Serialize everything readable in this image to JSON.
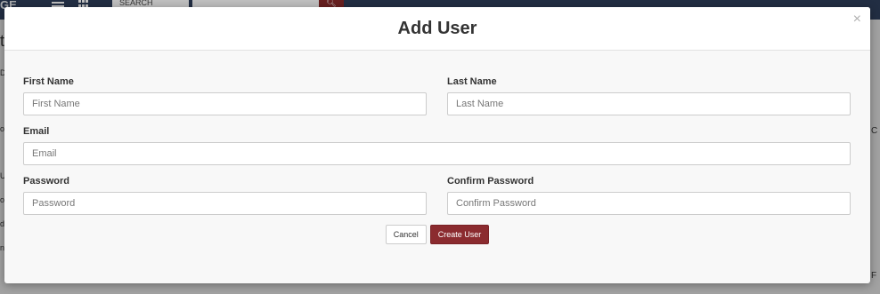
{
  "background": {
    "logo_fragment": "GE",
    "search_herd_label": "SEARCH HERD",
    "left_fragments": [
      "t",
      "D",
      "o",
      "U",
      "o",
      "d",
      "n"
    ],
    "right_fragments": [
      "C",
      "F"
    ]
  },
  "modal": {
    "title": "Add User",
    "close_symbol": "×",
    "fields": {
      "first_name": {
        "label": "First Name",
        "placeholder": "First Name",
        "value": ""
      },
      "last_name": {
        "label": "Last Name",
        "placeholder": "Last Name",
        "value": ""
      },
      "email": {
        "label": "Email",
        "placeholder": "Email",
        "value": ""
      },
      "password": {
        "label": "Password",
        "placeholder": "Password",
        "value": ""
      },
      "confirm_password": {
        "label": "Confirm Password",
        "placeholder": "Confirm Password",
        "value": ""
      }
    },
    "buttons": {
      "cancel": "Cancel",
      "create": "Create User"
    }
  },
  "colors": {
    "topbar": "#2e3e5a",
    "primary_button": "#8b2b2f",
    "modal_background": "#f8f8f8"
  },
  "icons": [
    "menu-icon",
    "grid-icon",
    "caret-down-icon",
    "search-icon",
    "close-icon"
  ]
}
